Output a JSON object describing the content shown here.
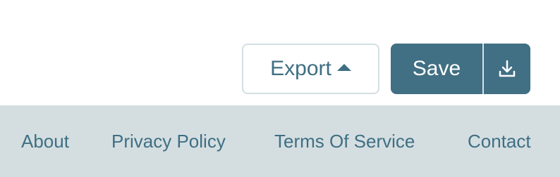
{
  "toolbar": {
    "export_label": "Export",
    "save_label": "Save"
  },
  "icons": {
    "export_caret": "caret-up-icon",
    "download": "download-icon"
  },
  "footer": {
    "links": [
      {
        "label": "About"
      },
      {
        "label": "Privacy Policy"
      },
      {
        "label": "Terms Of Service"
      },
      {
        "label": "Contact"
      }
    ]
  },
  "colors": {
    "primary": "#416f83",
    "text": "#3e6e83",
    "footer_bg": "#d4dee1",
    "border": "#d4dfe3"
  }
}
